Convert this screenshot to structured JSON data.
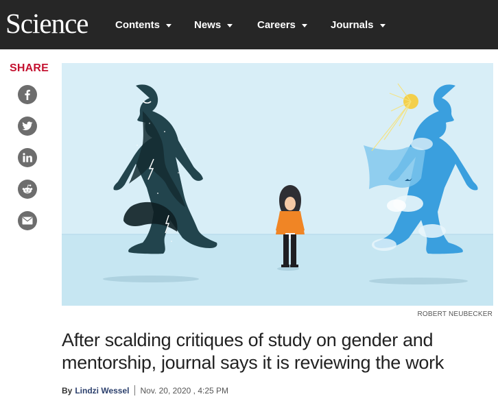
{
  "header": {
    "logo": "Science",
    "nav": [
      {
        "label": "Contents"
      },
      {
        "label": "News"
      },
      {
        "label": "Careers"
      },
      {
        "label": "Journals"
      }
    ]
  },
  "share": {
    "label": "SHARE",
    "buttons": [
      {
        "icon": "facebook-icon"
      },
      {
        "icon": "twitter-icon"
      },
      {
        "icon": "linkedin-icon"
      },
      {
        "icon": "reddit-icon"
      },
      {
        "icon": "email-icon"
      }
    ]
  },
  "article": {
    "image_credit": "ROBERT NEUBECKER",
    "headline": "After scalding critiques of study on gender and mentorship, journal says it is reviewing the work",
    "byline": {
      "by": "By",
      "author": "Lindzi Wessel",
      "date": "Nov. 20, 2020 , 4:25 PM"
    }
  },
  "colors": {
    "header_bg": "#262626",
    "share_red": "#c41230",
    "icon_gray": "#6d6d6d",
    "author_blue": "#2b3f6c"
  }
}
